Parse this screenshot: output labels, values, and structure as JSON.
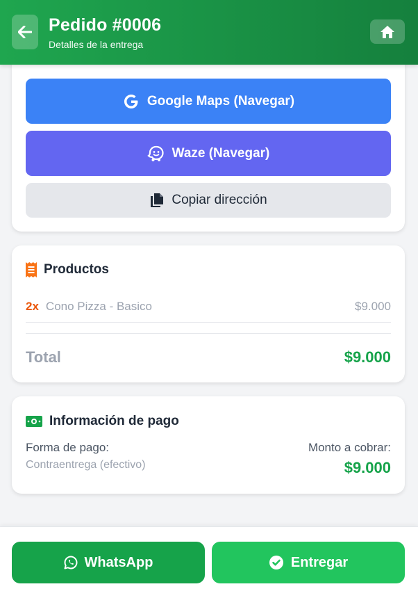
{
  "header": {
    "title": "Pedido #0006",
    "subtitle": "Detalles de la entrega",
    "back_icon": "arrow-left-icon",
    "home_icon": "home-icon"
  },
  "navigation": {
    "google_maps_label": "Google Maps (Navegar)",
    "waze_label": "Waze (Navegar)",
    "copy_label": "Copiar dirección"
  },
  "products": {
    "heading": "Productos",
    "items": [
      {
        "qty": "2x",
        "name": "Cono Pizza - Basico",
        "price": "$9.000"
      }
    ],
    "total_label": "Total",
    "total_value": "$9.000"
  },
  "payment": {
    "heading": "Información de pago",
    "method_label": "Forma de pago:",
    "method_value": "Contraentrega (efectivo)",
    "amount_label": "Monto a cobrar:",
    "amount_value": "$9.000"
  },
  "footer": {
    "whatsapp_label": "WhatsApp",
    "deliver_label": "Entregar"
  },
  "colors": {
    "header_green": "#15803d",
    "maps_blue": "#3b82f6",
    "waze_indigo": "#6366f1",
    "price_green": "#16a34a",
    "qty_orange": "#ea580c"
  }
}
